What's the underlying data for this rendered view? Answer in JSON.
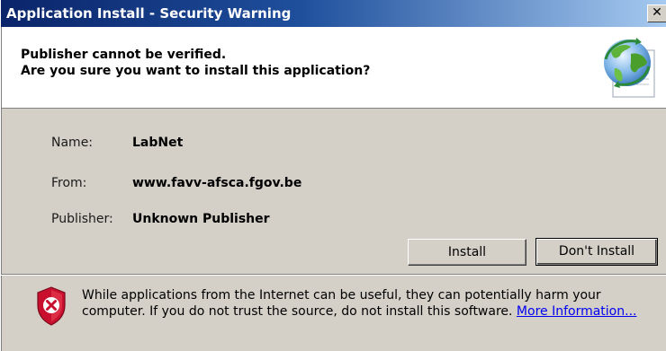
{
  "window": {
    "title": "Application Install - Security Warning",
    "close_glyph": "✕"
  },
  "header": {
    "line1": "Publisher cannot be verified.",
    "line2": "Are you sure you want to install this application?",
    "icon": "globe-icon"
  },
  "details": {
    "name_label": "Name:",
    "name_value": "LabNet",
    "from_label": "From:",
    "from_value": "www.favv-afsca.fgov.be",
    "publisher_label": "Publisher:",
    "publisher_value": "Unknown Publisher"
  },
  "buttons": {
    "install": "Install",
    "dont_install": "Don't Install"
  },
  "warning": {
    "icon": "shield-warning-icon",
    "line1": "While applications from the Internet can be useful, they can potentially harm your",
    "line2_prefix": "computer. If you do not trust the source, do not install this software. ",
    "link": "More Information..."
  },
  "colors": {
    "titlebar_start": "#0a246a",
    "titlebar_end": "#a6caf0",
    "dialog_bg": "#d4d0c8",
    "link": "#0000ee",
    "shield_red": "#c8102e"
  }
}
